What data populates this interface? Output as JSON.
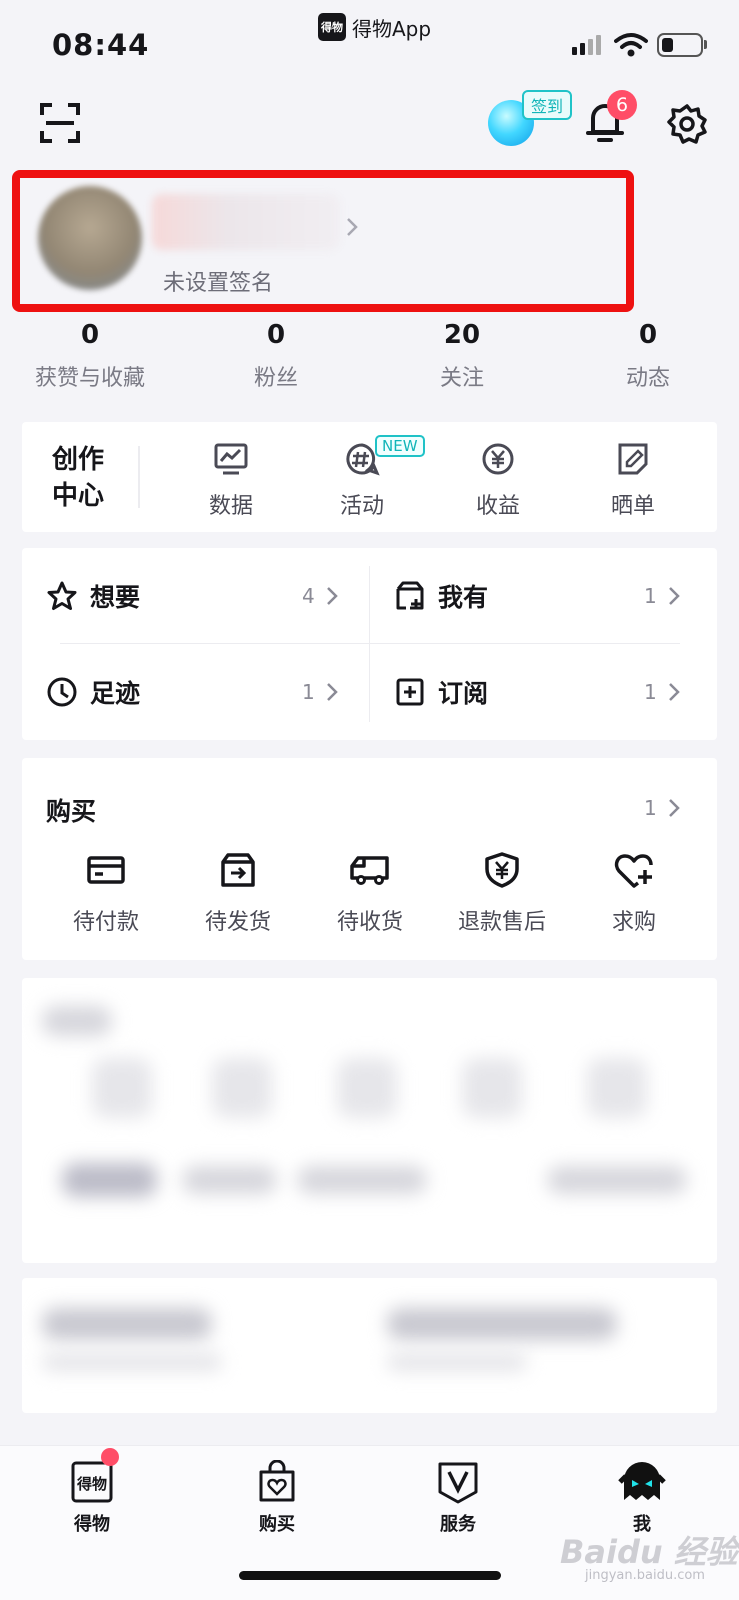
{
  "status_bar": {
    "time": "08:44",
    "app_name": "得物App",
    "app_logo": "得物"
  },
  "header": {
    "checkin_label": "签到",
    "notification_count": "6"
  },
  "profile": {
    "signature": "未设置签名"
  },
  "stats": [
    {
      "value": "0",
      "label": "获赞与收藏"
    },
    {
      "value": "0",
      "label": "粉丝"
    },
    {
      "value": "20",
      "label": "关注"
    },
    {
      "value": "0",
      "label": "动态"
    }
  ],
  "creator_center": {
    "title": "创作中心",
    "items": [
      {
        "label": "数据",
        "icon": "chart-icon"
      },
      {
        "label": "活动",
        "icon": "hashtag-icon"
      },
      {
        "label": "收益",
        "icon": "yen-coin-icon"
      },
      {
        "label": "晒单",
        "icon": "edit-note-icon"
      }
    ],
    "new_badge": "NEW"
  },
  "collections": {
    "wants": {
      "label": "想要",
      "count": "4"
    },
    "owned": {
      "label": "我有",
      "count": "1"
    },
    "history": {
      "label": "足迹",
      "count": "1"
    },
    "subscriptions": {
      "label": "订阅",
      "count": "1"
    }
  },
  "purchases": {
    "title": "购买",
    "count": "1",
    "items": [
      {
        "label": "待付款"
      },
      {
        "label": "待发货"
      },
      {
        "label": "待收货"
      },
      {
        "label": "退款售后"
      },
      {
        "label": "求购"
      }
    ]
  },
  "tabbar": {
    "tabs": [
      {
        "label": "得物"
      },
      {
        "label": "购买"
      },
      {
        "label": "服务"
      },
      {
        "label": "我"
      }
    ],
    "home_logo": "得物"
  },
  "watermark": {
    "text": "Baidu 经验",
    "url": "jingyan.baidu.com"
  },
  "colors": {
    "accent_red": "#ee1111",
    "badge_red": "#ff4d67",
    "teal": "#20c3c8"
  }
}
